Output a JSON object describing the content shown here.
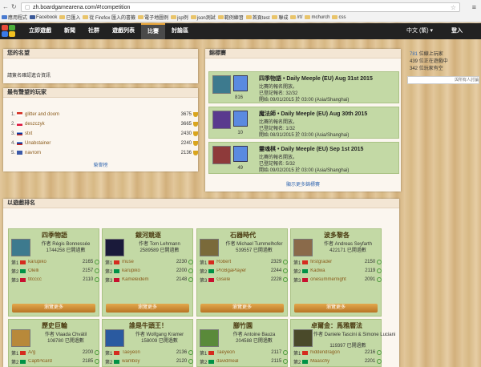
{
  "browser": {
    "url": "zh.boardgamearena.com/#!competition"
  },
  "bookmarks": [
    "應用程式",
    "Facebook",
    "已匯入",
    "從 Firefox 匯入的書籤",
    "電子地圖例",
    "jsp例",
    "json測試",
    "範例練習",
    "首頁test",
    "聯成",
    "/rt/",
    "mchurch",
    "css"
  ],
  "nav": {
    "items": [
      "立即遊戲",
      "新聞",
      "社群",
      "遊戲列表",
      "比賽",
      "討論區"
    ],
    "active": 4,
    "lang": "中文 (繁)",
    "login": "登入"
  },
  "name_panel": {
    "title": "您的名望",
    "text": "請簽名確認進合資訊"
  },
  "top_players": {
    "title": "最有聲望的玩家",
    "rows": [
      {
        "rank": "1.",
        "name": "glitter and doom",
        "score": "3675"
      },
      {
        "rank": "2.",
        "name": "deszczyk",
        "score": "3665"
      },
      {
        "rank": "3.",
        "name": "stxt",
        "score": "2430"
      },
      {
        "rank": "4.",
        "name": "Unabstainer",
        "score": "2240"
      },
      {
        "rank": "5.",
        "name": "navrom",
        "score": "2136"
      }
    ],
    "link": "榮譽榜"
  },
  "tournaments": {
    "title": "錦標賽",
    "items": [
      {
        "title": "四季物語 • Daily Meeple (EU) Aug 31st 2015",
        "l1": "比賽的報名開放。",
        "l2": "已登記報名: 32/32",
        "l3": "開始 09/01/2015 於 03:00 (Asia/Shanghai)",
        "count": "816"
      },
      {
        "title": "魔法師 • Daily Meeple (EU) Aug 30th 2015",
        "l1": "比賽的報名開放。",
        "l2": "已登記報名: 1/32",
        "l3": "開始 08/31/2015 於 03:00 (Asia/Shanghai)",
        "count": "10"
      },
      {
        "title": "靈魂棋 • Daily Meeple (EU) Sep 1st 2015",
        "l1": "比賽的報名開放。",
        "l2": "已登記報名: 5/32",
        "l3": "開始 09/02/2015 於 03:00 (Asia/Shanghai)",
        "count": "49"
      }
    ],
    "more": "顯示更多錦標賽"
  },
  "online": {
    "players": "781",
    "players_label": "位線上玩家",
    "waiting": "439",
    "waiting_label": "位正在遊戲中",
    "more": "342",
    "more_label": "位玩家有空",
    "placeholder": "與所有人討論"
  },
  "rankings": {
    "title": "以遊戲排名",
    "button": "瀏覽更多",
    "games": [
      {
        "title": "四季物語",
        "by": "作者 Régis Bonnessée",
        "stat": "1744258",
        "stat_label": "已開過數",
        "thumb": "#3d7a8e",
        "rows": [
          {
            "n": "karupiko",
            "s": "2165"
          },
          {
            "n": "Olelli",
            "s": "2157"
          },
          {
            "n": "titcccc",
            "s": "2110"
          }
        ]
      },
      {
        "title": "銀河競逐",
        "by": "作者 Tom Lehmann",
        "stat": "2589589",
        "stat_label": "已開過數",
        "thumb": "#1a1a3a",
        "rows": [
          {
            "n": "muse",
            "s": "2230"
          },
          {
            "n": "karupiko",
            "s": "2200"
          },
          {
            "n": "Kameleidem",
            "s": "2148"
          }
        ]
      },
      {
        "title": "石器時代",
        "by": "作者 Michael Tummelhofer",
        "stat": "539557",
        "stat_label": "已開過數",
        "thumb": "#7a6a3a",
        "rows": [
          {
            "n": "Robert",
            "s": "2329"
          },
          {
            "n": "ProBgaPlayer",
            "s": "2244"
          },
          {
            "n": "Gisele",
            "s": "2228"
          }
        ]
      },
      {
        "title": "波多黎各",
        "by": "作者 Andreas Seyfarth",
        "stat": "422171",
        "stat_label": "已開過數",
        "thumb": "#8a6a4a",
        "rows": [
          {
            "n": "firstgrader",
            "s": "2150"
          },
          {
            "n": "Kadwa",
            "s": "2119"
          },
          {
            "n": "onesummernight",
            "s": "2091"
          }
        ]
      }
    ],
    "games2": [
      {
        "title": "歷史巨輪",
        "by": "作者 Vlaada Chvátil",
        "stat": "108780",
        "stat_label": "已開過數",
        "thumb": "#b8893a",
        "rows": [
          {
            "n": "A/g",
            "s": "2200"
          },
          {
            "n": "CaptPicard",
            "s": "2185"
          }
        ]
      },
      {
        "title": "誰是牛頭王！",
        "by": "作者 Wolfgang Kramer",
        "stat": "158009",
        "stat_label": "已開過數",
        "thumb": "#2a5aa0",
        "rows": [
          {
            "n": "Taeyeon",
            "s": "2136"
          },
          {
            "n": "wamboy",
            "s": "2120"
          }
        ]
      },
      {
        "title": "腳竹園",
        "by": "作者 Antoine Bauza",
        "stat": "204588",
        "stat_label": "已開過數",
        "thumb": "#5a8a3a",
        "rows": [
          {
            "n": "Taeyeon",
            "s": "2117"
          },
          {
            "n": "davidmeal",
            "s": "2115"
          }
        ]
      },
      {
        "title": "卓爾金：馬雅曆法",
        "by": "作者 Daniele Tascini & Simone Luciani",
        "stat": "119397",
        "stat_label": "已開過數",
        "thumb": "#4a4a2a",
        "rows": [
          {
            "n": "hiddendragon",
            "s": "2216"
          },
          {
            "n": "Maaschy",
            "s": "2201"
          }
        ]
      }
    ]
  }
}
